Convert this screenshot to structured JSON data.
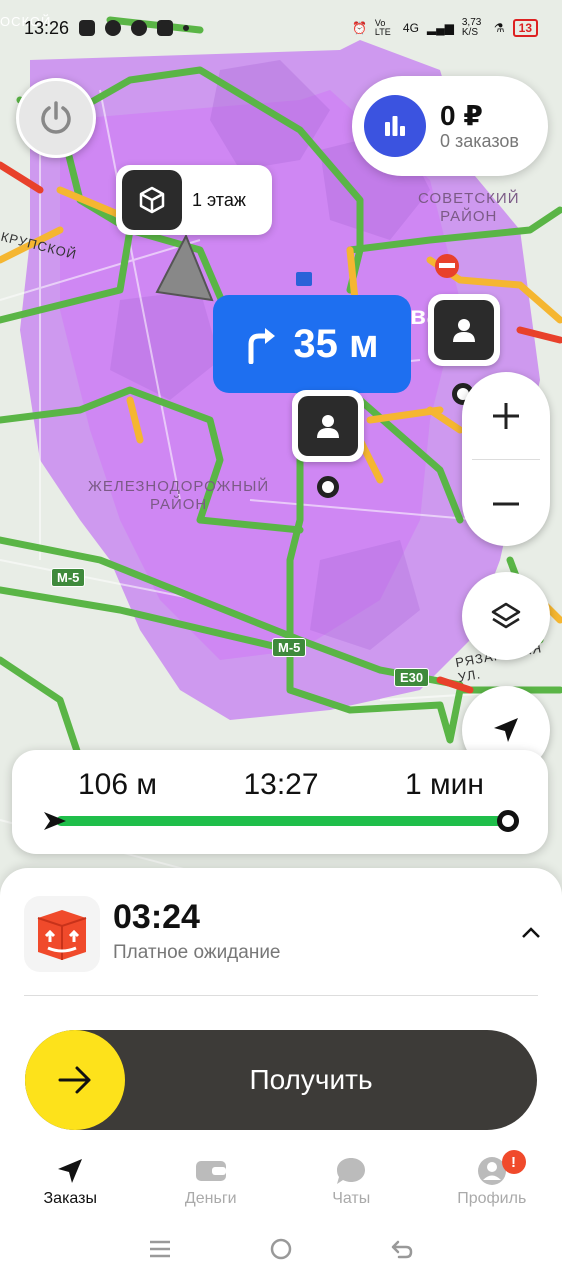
{
  "status_bar": {
    "time": "13:26",
    "network_lte": "Vo LTE",
    "network_4g": "4G",
    "speed": "3,73 K/S",
    "battery": "13"
  },
  "map": {
    "labels": {
      "district_sovetsky": "СОВЕТСКИЙ\nРАЙОН",
      "district_zheleznodorozhny": "ЖЕЛЕЗНОДОРОЖНЫЙ\nРАЙОН",
      "street_krupskoy": "КРУПСКОЙ",
      "street_ryazanskaya": "РЯЗАНСКАЯ УЛ.",
      "top_left_text": "ОСКОЙ",
      "partial_text": "ва"
    },
    "highway_badges": [
      "М-5",
      "М-5",
      "E30"
    ]
  },
  "earnings": {
    "amount": "0 ₽",
    "orders": "0 заказов"
  },
  "floor_tooltip": {
    "label": "1 этаж"
  },
  "maneuver": {
    "distance": "35 м"
  },
  "route": {
    "distance": "106 м",
    "arrival_time": "13:27",
    "duration": "1 мин",
    "progress": 0.0
  },
  "order": {
    "timer": "03:24",
    "status": "Платное ожидание"
  },
  "action": {
    "receive_label": "Получить"
  },
  "tabs": [
    {
      "label": "Заказы",
      "icon": "navigation-arrow-icon",
      "active": true
    },
    {
      "label": "Деньги",
      "icon": "wallet-icon",
      "active": false
    },
    {
      "label": "Чаты",
      "icon": "chat-bubble-icon",
      "active": false
    },
    {
      "label": "Профиль",
      "icon": "profile-icon",
      "active": false,
      "badge": "!"
    }
  ],
  "colors": {
    "accent_blue": "#1e6ff0",
    "earnings_blue": "#3b53e0",
    "slider_yellow": "#fde21b",
    "slider_dark": "#3d3b38",
    "route_green": "#1fbe4a",
    "zone_purple": "#c478f0",
    "badge_red": "#f04a2b"
  }
}
